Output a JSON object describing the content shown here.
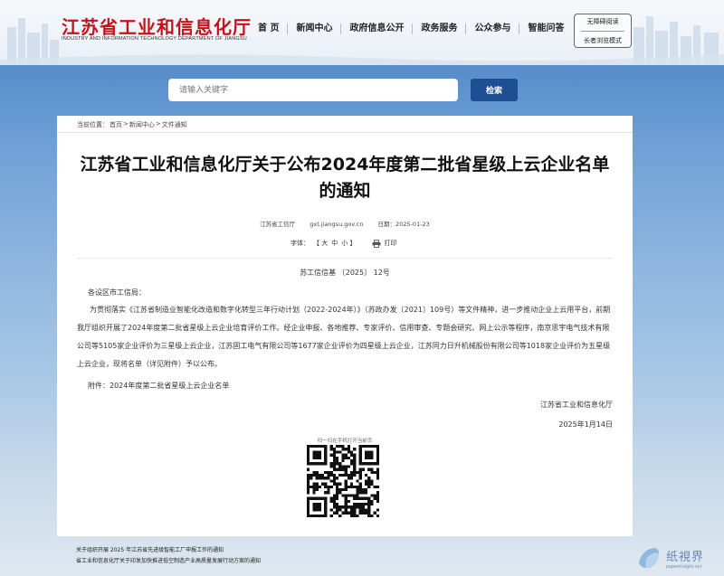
{
  "header": {
    "title": "江苏省工业和信息化厅",
    "subtitle": "INDUSTRY AND INFORMATION TECHNOLOGY DEPARTMENT OF JIANGSU"
  },
  "nav": {
    "items": [
      "首 页",
      "新闻中心",
      "政府信息公开",
      "政务服务",
      "公众参与",
      "智能问答"
    ]
  },
  "accessibility": {
    "barrier_free": "无障碍阅读",
    "elder_mode": "长者浏览模式"
  },
  "search": {
    "placeholder": "请输入关键字",
    "button_label": "检索"
  },
  "breadcrumb": {
    "prefix": "当前位置：",
    "items": [
      "首页",
      "新闻中心",
      "文件通知"
    ],
    "separator": ">"
  },
  "article": {
    "title": "江苏省工业和信息化厅关于公布2024年度第二批省星级上云企业名单的通知",
    "source": "江苏省工信厅",
    "site": "gxt.jiangsu.gov.cn",
    "date_label": "日期：2025-01-23",
    "font_label": "字体：",
    "font_sizes": [
      "【 大",
      "中",
      "小 】"
    ],
    "print_label": "打印",
    "doc_number": "苏工信信基 〔2025〕 12号",
    "salutation": "各设区市工信局：",
    "paragraph": "为贯彻落实《江苏省制造业智能化改造和数字化转型三年行动计划（2022-2024年）》（苏政办发〔2021〕109号）等文件精神，进一步推动企业上云用平台，前期我厅组织开展了2024年度第二批省星级上云企业培育评价工作。经企业申报、各地推荐、专家评价、信用审查、专题会研究、网上公示等程序，南京思宇电气技术有限公司等5105家企业评价为三星级上云企业，江苏固工电气有限公司等1677家企业评价为四星级上云企业，江苏同力日升机械股份有限公司等1018家企业评价为五星级上云企业，现将名单（详见附件）予以公布。",
    "attachment": "附件：2024年度第二批省星级上云企业名单",
    "sign_org": "江苏省工业和信息化厅",
    "sign_date": "2025年1月14日",
    "qr_caption": "扫一扫在手机打开当前页"
  },
  "related": {
    "items": [
      "关于组织开展 2025 年江苏省先进级智能工厂申报工作的通知",
      "省工业和信息化厅关于印发加快推进低空制造产业高质量发展行动方案的通知"
    ]
  },
  "watermark": {
    "name": "纸視界",
    "url": "paperinsight.net"
  }
}
